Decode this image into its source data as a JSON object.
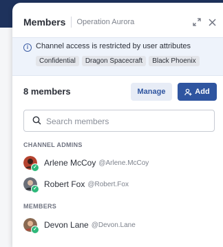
{
  "header": {
    "title": "Members",
    "channel": "Operation Aurora"
  },
  "banner": {
    "text": "Channel access is restricted by user attributes",
    "tags": [
      "Confidential",
      "Dragon Spacecraft",
      "Black Phoenix"
    ]
  },
  "members_bar": {
    "count": "8 members",
    "manage_label": "Manage",
    "add_label": "Add"
  },
  "search": {
    "placeholder": "Search members"
  },
  "sections": {
    "admins": {
      "title": "CHANNEL ADMINS",
      "items": [
        {
          "name": "Arlene McCoy",
          "handle": "@Arlene.McCoy"
        },
        {
          "name": "Robert Fox",
          "handle": "@Robert.Fox"
        }
      ]
    },
    "members": {
      "title": "MEMBERS",
      "items": [
        {
          "name": "Devon Lane",
          "handle": "@Devon.Lane"
        }
      ]
    }
  },
  "colors": {
    "accent": "#2f55a0",
    "online": "#2eb87a",
    "banner_bg": "#eef3fb"
  },
  "icons": [
    "expand-icon",
    "close-icon",
    "info-icon",
    "add-user-icon",
    "search-icon",
    "online-check-icon"
  ]
}
